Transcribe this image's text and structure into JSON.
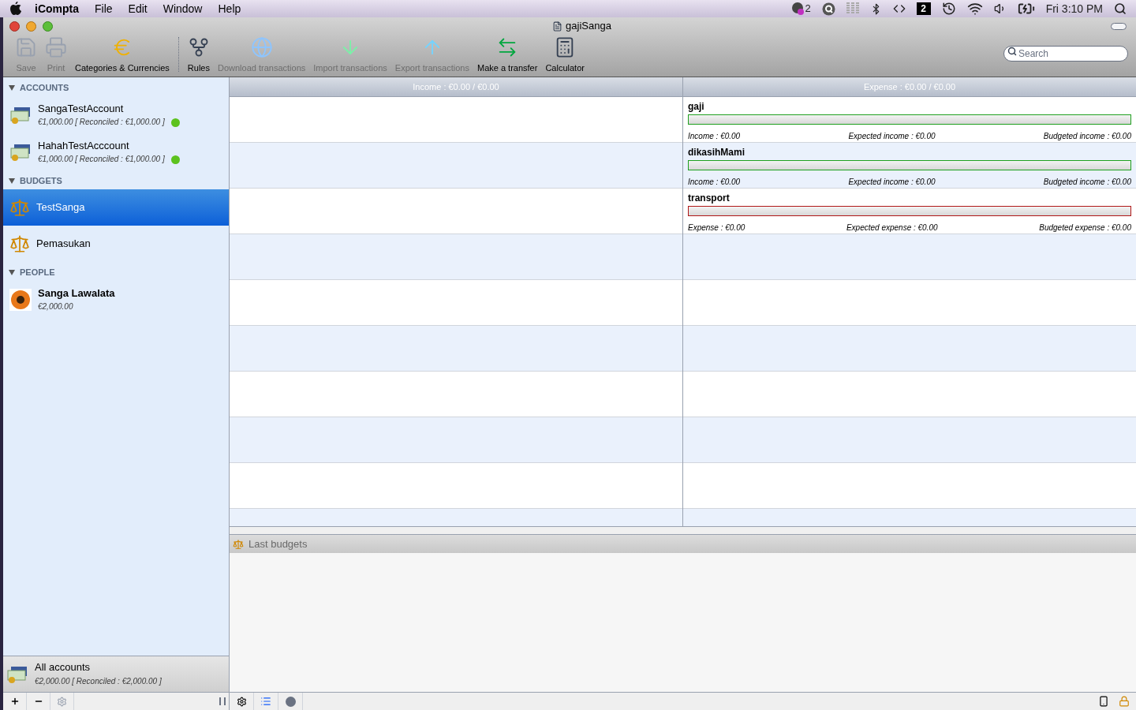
{
  "menubar": {
    "app": "iCompta",
    "menus": [
      "File",
      "Edit",
      "Window",
      "Help"
    ],
    "badge_count": "2",
    "spaces_number": "2",
    "clock": "Fri 3:10 PM"
  },
  "window": {
    "title": "gajiSanga"
  },
  "toolbar": {
    "items": [
      {
        "kind": "save",
        "label": "Save",
        "disabled": true
      },
      {
        "kind": "print",
        "label": "Print",
        "disabled": true
      },
      {
        "kind": "currency",
        "label": "Categories & Currencies",
        "disabled": false
      },
      {
        "kind": "rules",
        "label": "Rules",
        "disabled": false
      },
      {
        "kind": "download",
        "label": "Download transactions",
        "disabled": true
      },
      {
        "kind": "import",
        "label": "Import transactions",
        "disabled": true
      },
      {
        "kind": "export",
        "label": "Export transactions",
        "disabled": true
      },
      {
        "kind": "transfer",
        "label": "Make a transfer",
        "disabled": false
      },
      {
        "kind": "calculator",
        "label": "Calculator",
        "disabled": false
      }
    ],
    "search": {
      "placeholder": "Search"
    }
  },
  "sidebar": {
    "sections": [
      {
        "title": "ACCOUNTS",
        "expanded": true,
        "items": [
          {
            "kind": "account",
            "name": "SangaTestAccount",
            "detail": "€1,000.00 [ Reconciled : €1,000.00 ]",
            "color": "#5cc21e",
            "selected": false
          },
          {
            "kind": "account",
            "name": "HahahTestAcccount",
            "detail": "€1,000.00 [ Reconciled : €1,000.00 ]",
            "color": "#5cc21e",
            "selected": false
          }
        ]
      },
      {
        "title": "BUDGETS",
        "expanded": true,
        "items": [
          {
            "kind": "budget",
            "name": "TestSanga",
            "selected": true
          },
          {
            "kind": "budget",
            "name": "Pemasukan",
            "selected": false
          }
        ]
      },
      {
        "title": "PEOPLE",
        "expanded": true,
        "items": [
          {
            "kind": "person",
            "name": "Sanga Lawalata",
            "detail": "€2,000.00",
            "selected": false
          }
        ]
      }
    ],
    "summary": {
      "name": "All accounts",
      "detail": "€2,000.00 [ Reconciled : €2,000.00 ]"
    }
  },
  "budget_table": {
    "columns": [
      "Income : €0.00 / €0.00",
      "Expense : €0.00 / €0.00"
    ],
    "expense_items": [
      {
        "name": "gaji",
        "color": "#1fa01f",
        "stats": [
          "Income : €0.00",
          "Expected income : €0.00",
          "Budgeted income : €0.00"
        ]
      },
      {
        "name": "dikasihMami",
        "color": "#1fa01f",
        "stats": [
          "Income : €0.00",
          "Expected income : €0.00",
          "Budgeted income : €0.00"
        ]
      },
      {
        "name": "transport",
        "color": "#b01818",
        "stats": [
          "Expense : €0.00",
          "Expected expense : €0.00",
          "Budgeted expense : €0.00"
        ]
      }
    ]
  },
  "last_budgets": {
    "title": "Last budgets"
  }
}
